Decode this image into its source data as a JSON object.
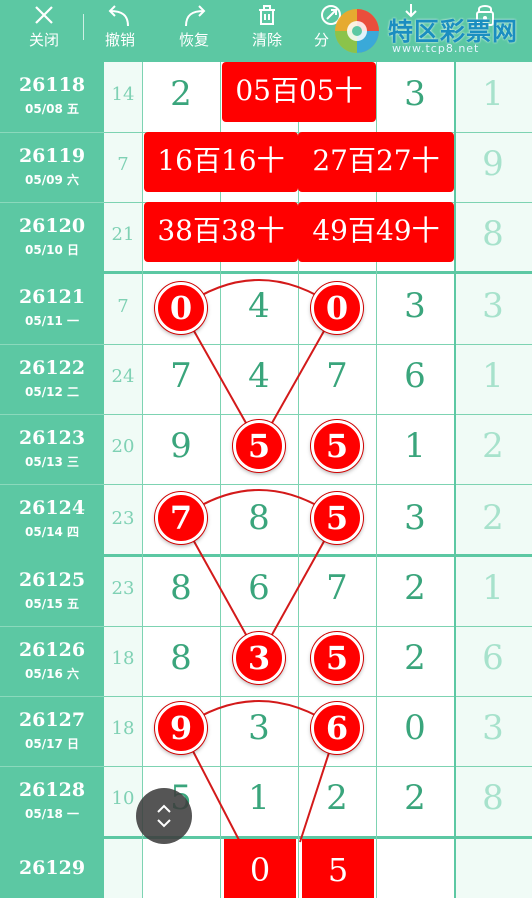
{
  "toolbar": {
    "close_label": "关闭",
    "undo_label": "撤销",
    "redo_label": "恢复",
    "clear_label": "清除",
    "share_label": "分",
    "brand_name": "特区彩票网",
    "brand_url": "www.tcp8.net",
    "icons": [
      "close-icon",
      "undo-icon",
      "redo-icon",
      "trash-icon",
      "share-icon",
      "download-icon",
      "lock-icon"
    ]
  },
  "colors": {
    "header_green": "#5cc8a3",
    "digit_green": "#3aa57c",
    "red": "#ff0000"
  },
  "rows": [
    {
      "issue": "26118",
      "date": "05/08 五",
      "count": "14",
      "d1": "2",
      "d4": "3",
      "d5": "1",
      "box": "05百05十"
    },
    {
      "issue": "26119",
      "date": "05/09 六",
      "count": "7",
      "d5": "9",
      "box_a": "16百16十",
      "box_b": "27百27十"
    },
    {
      "issue": "26120",
      "date": "05/10 日",
      "count": "21",
      "d5": "8",
      "box_a": "38百38十",
      "box_b": "49百49十"
    },
    {
      "issue": "26121",
      "date": "05/11 一",
      "count": "7",
      "d1": "0",
      "d2": "4",
      "d3": "0",
      "d4": "3",
      "d5": "3"
    },
    {
      "issue": "26122",
      "date": "05/12 二",
      "count": "24",
      "d1": "7",
      "d2": "4",
      "d3": "7",
      "d4": "6",
      "d5": "1"
    },
    {
      "issue": "26123",
      "date": "05/13 三",
      "count": "20",
      "d1": "9",
      "d2": "5",
      "d3": "5",
      "d4": "1",
      "d5": "2"
    },
    {
      "issue": "26124",
      "date": "05/14 四",
      "count": "23",
      "d1": "7",
      "d2": "8",
      "d3": "5",
      "d4": "3",
      "d5": "2"
    },
    {
      "issue": "26125",
      "date": "05/15 五",
      "count": "23",
      "d1": "8",
      "d2": "6",
      "d3": "7",
      "d4": "2",
      "d5": "1"
    },
    {
      "issue": "26126",
      "date": "05/16 六",
      "count": "18",
      "d1": "8",
      "d2": "3",
      "d3": "5",
      "d4": "2",
      "d5": "6"
    },
    {
      "issue": "26127",
      "date": "05/17 日",
      "count": "18",
      "d1": "9",
      "d2": "3",
      "d3": "6",
      "d4": "0",
      "d5": "3"
    },
    {
      "issue": "26128",
      "date": "05/18 一",
      "count": "10",
      "d1": "5",
      "d2": "1",
      "d3": "2",
      "d4": "2",
      "d5": "8"
    },
    {
      "issue": "26129",
      "p1": "0",
      "p2": "5"
    }
  ]
}
